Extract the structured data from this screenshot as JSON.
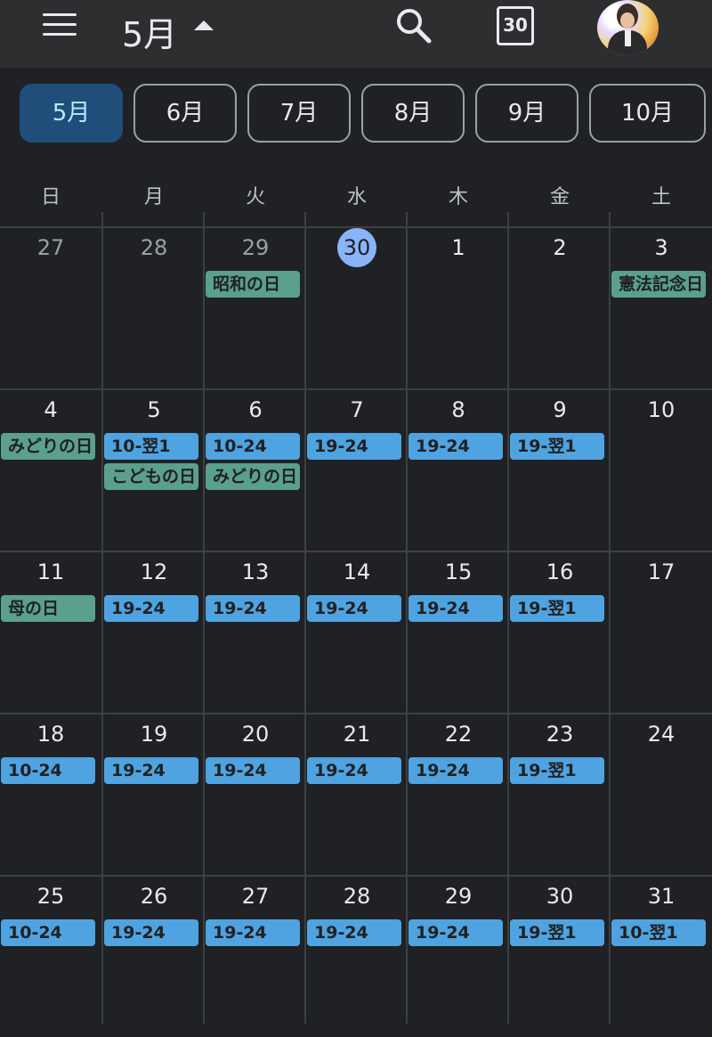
{
  "header": {
    "month_title": "5月",
    "today_icon_number": "30"
  },
  "month_tabs": [
    "5月",
    "6月",
    "7月",
    "8月",
    "9月",
    "10月"
  ],
  "weekdays": [
    "日",
    "月",
    "火",
    "水",
    "木",
    "金",
    "土"
  ],
  "weeks": [
    {
      "days": [
        {
          "num": "27",
          "muted": true,
          "events": []
        },
        {
          "num": "28",
          "muted": true,
          "events": []
        },
        {
          "num": "29",
          "muted": true,
          "events": [
            {
              "label": "昭和の日",
              "kind": "holiday"
            }
          ]
        },
        {
          "num": "30",
          "today": true,
          "events": []
        },
        {
          "num": "1",
          "events": []
        },
        {
          "num": "2",
          "events": []
        },
        {
          "num": "3",
          "events": [
            {
              "label": "憲法記念日",
              "kind": "holiday"
            }
          ]
        }
      ]
    },
    {
      "days": [
        {
          "num": "4",
          "events": [
            {
              "label": "みどりの日",
              "kind": "holiday"
            }
          ]
        },
        {
          "num": "5",
          "events": [
            {
              "label": "10-翌1",
              "kind": "shift"
            },
            {
              "label": "こどもの日",
              "kind": "holiday"
            }
          ]
        },
        {
          "num": "6",
          "events": [
            {
              "label": "10-24",
              "kind": "shift"
            },
            {
              "label": "みどりの日",
              "kind": "holiday"
            }
          ]
        },
        {
          "num": "7",
          "events": [
            {
              "label": "19-24",
              "kind": "shift"
            }
          ]
        },
        {
          "num": "8",
          "events": [
            {
              "label": "19-24",
              "kind": "shift"
            }
          ]
        },
        {
          "num": "9",
          "events": [
            {
              "label": "19-翌1",
              "kind": "shift"
            }
          ]
        },
        {
          "num": "10",
          "events": []
        }
      ]
    },
    {
      "days": [
        {
          "num": "11",
          "events": [
            {
              "label": "母の日",
              "kind": "holiday"
            }
          ]
        },
        {
          "num": "12",
          "events": [
            {
              "label": "19-24",
              "kind": "shift"
            }
          ]
        },
        {
          "num": "13",
          "events": [
            {
              "label": "19-24",
              "kind": "shift"
            }
          ]
        },
        {
          "num": "14",
          "events": [
            {
              "label": "19-24",
              "kind": "shift"
            }
          ]
        },
        {
          "num": "15",
          "events": [
            {
              "label": "19-24",
              "kind": "shift"
            }
          ]
        },
        {
          "num": "16",
          "events": [
            {
              "label": "19-翌1",
              "kind": "shift"
            }
          ]
        },
        {
          "num": "17",
          "events": []
        }
      ]
    },
    {
      "days": [
        {
          "num": "18",
          "events": [
            {
              "label": "10-24",
              "kind": "shift"
            }
          ]
        },
        {
          "num": "19",
          "events": [
            {
              "label": "19-24",
              "kind": "shift"
            }
          ]
        },
        {
          "num": "20",
          "events": [
            {
              "label": "19-24",
              "kind": "shift"
            }
          ]
        },
        {
          "num": "21",
          "events": [
            {
              "label": "19-24",
              "kind": "shift"
            }
          ]
        },
        {
          "num": "22",
          "events": [
            {
              "label": "19-24",
              "kind": "shift"
            }
          ]
        },
        {
          "num": "23",
          "events": [
            {
              "label": "19-翌1",
              "kind": "shift"
            }
          ]
        },
        {
          "num": "24",
          "events": []
        }
      ]
    },
    {
      "days": [
        {
          "num": "25",
          "events": [
            {
              "label": "10-24",
              "kind": "shift"
            }
          ]
        },
        {
          "num": "26",
          "events": [
            {
              "label": "19-24",
              "kind": "shift"
            }
          ]
        },
        {
          "num": "27",
          "events": [
            {
              "label": "19-24",
              "kind": "shift"
            }
          ]
        },
        {
          "num": "28",
          "events": [
            {
              "label": "19-24",
              "kind": "shift"
            }
          ]
        },
        {
          "num": "29",
          "events": [
            {
              "label": "19-24",
              "kind": "shift"
            }
          ]
        },
        {
          "num": "30",
          "events": [
            {
              "label": "19-翌1",
              "kind": "shift"
            }
          ]
        },
        {
          "num": "31",
          "events": [
            {
              "label": "10-翌1",
              "kind": "shift"
            }
          ]
        }
      ]
    }
  ],
  "colors": {
    "background": "#202124",
    "topbar": "#2d2e30",
    "active_tab": "#1f4e7a",
    "today_circle": "#8ab4f8",
    "holiday_event": "#5b9f8d",
    "shift_event": "#4fa3e0"
  },
  "icons": [
    "menu-icon",
    "chevron-up-icon",
    "search-icon",
    "calendar-today-icon",
    "avatar"
  ]
}
